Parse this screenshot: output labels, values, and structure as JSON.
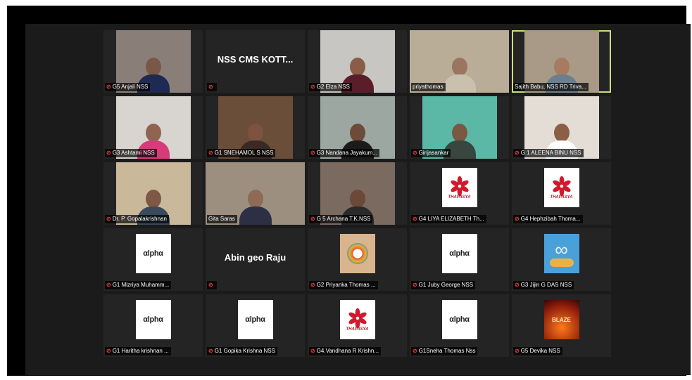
{
  "participants": [
    {
      "name": "G5 Anjali NSS",
      "muted": true,
      "kind": "video",
      "bg": "#8a7f78",
      "skin": "#7a5848",
      "shirt": "#1e2a52"
    },
    {
      "name": "",
      "muted": true,
      "kind": "text",
      "display": "NSS CMS KOTT..."
    },
    {
      "name": "G2 Elza NSS",
      "muted": true,
      "kind": "video",
      "bg": "#c8c6c2",
      "skin": "#8a5d48",
      "shirt": "#5a1e2a"
    },
    {
      "name": "priyathomas",
      "muted": false,
      "kind": "wide",
      "bg": "#b9ad98",
      "skin": "#9a7560",
      "shirt": "#c9c1ae"
    },
    {
      "name": "Sajith Babu, NSS RD Triva...",
      "muted": false,
      "kind": "video",
      "bg": "#a89a86",
      "skin": "#a87a60",
      "shirt": "#6d7f8c",
      "active": true
    },
    {
      "name": "G3 Ashtami NSS",
      "muted": true,
      "kind": "video",
      "bg": "#d8d4cf",
      "skin": "#8f6450",
      "shirt": "#d63c7a"
    },
    {
      "name": "G1 SNEHAMOL S NSS",
      "muted": true,
      "kind": "video",
      "bg": "#6b4e3a",
      "skin": "#7d5240",
      "shirt": "#3a2a24"
    },
    {
      "name": "G3 Nandana Jayakum...",
      "muted": true,
      "kind": "video",
      "bg": "#9da7a1",
      "skin": "#6e4a3a",
      "shirt": "#1b1b1b"
    },
    {
      "name": "Girijasankar",
      "muted": true,
      "kind": "video",
      "bg": "#5bb8a6",
      "skin": "#7a5844",
      "shirt": "#38463f"
    },
    {
      "name": "G 1 ALEENA BINU NSS",
      "muted": true,
      "kind": "video",
      "bg": "#e3ddd6",
      "skin": "#8b5e46",
      "shirt": "#ffffff"
    },
    {
      "name": "Dr. P. Gopalakrishnan",
      "muted": true,
      "kind": "video",
      "bg": "#c9b89a",
      "skin": "#7c5845",
      "shirt": "#3a4a5c"
    },
    {
      "name": "Gita Saras",
      "muted": false,
      "kind": "wide",
      "bg": "#9c8f80",
      "skin": "#8f6a56",
      "shirt": "#2d2f45"
    },
    {
      "name": "G 5 Archana T.K.NSS",
      "muted": true,
      "kind": "video",
      "bg": "#7a6a60",
      "skin": "#6b4838",
      "shirt": "#2a2a2a"
    },
    {
      "name": "G4 LIYA ELIZABETH Th...",
      "muted": true,
      "kind": "thapasya",
      "logo_text": "THAPASYA"
    },
    {
      "name": "G4 Hephzibah Thoma...",
      "muted": true,
      "kind": "thapasya",
      "logo_text": "THAPASYA"
    },
    {
      "name": "G1 Mizriya Muhamm...",
      "muted": true,
      "kind": "alpha",
      "logo_text": "αlphα"
    },
    {
      "name": "",
      "muted": true,
      "kind": "text",
      "display": "Abin geo Raju"
    },
    {
      "name": "G2 Priyanka Thomas ...",
      "muted": true,
      "kind": "hands"
    },
    {
      "name": "G1 Juby George NSS",
      "muted": true,
      "kind": "alpha",
      "logo_text": "αlphα"
    },
    {
      "name": "G3 Jijin G DAS NSS",
      "muted": true,
      "kind": "infinity"
    },
    {
      "name": "G1 Haritha krishnan ...",
      "muted": true,
      "kind": "alpha",
      "logo_text": "αlphα"
    },
    {
      "name": "G1 Gopika Krishna NSS",
      "muted": true,
      "kind": "alpha",
      "logo_text": "αlphα"
    },
    {
      "name": "G4.Vandhana R Krishn...",
      "muted": true,
      "kind": "thapasya",
      "logo_text": "THAPASYA"
    },
    {
      "name": "G1Sneha Thomas Nss",
      "muted": true,
      "kind": "alpha",
      "logo_text": "αlphα"
    },
    {
      "name": "G5 Devika NSS",
      "muted": true,
      "kind": "blaze",
      "logo_text": "BLAZE"
    }
  ],
  "icons": {
    "muted": "mic-muted-icon"
  },
  "colors": {
    "active_border": "#c8e07a",
    "muted_icon": "#e23a3a",
    "tile_bg": "#242424"
  }
}
